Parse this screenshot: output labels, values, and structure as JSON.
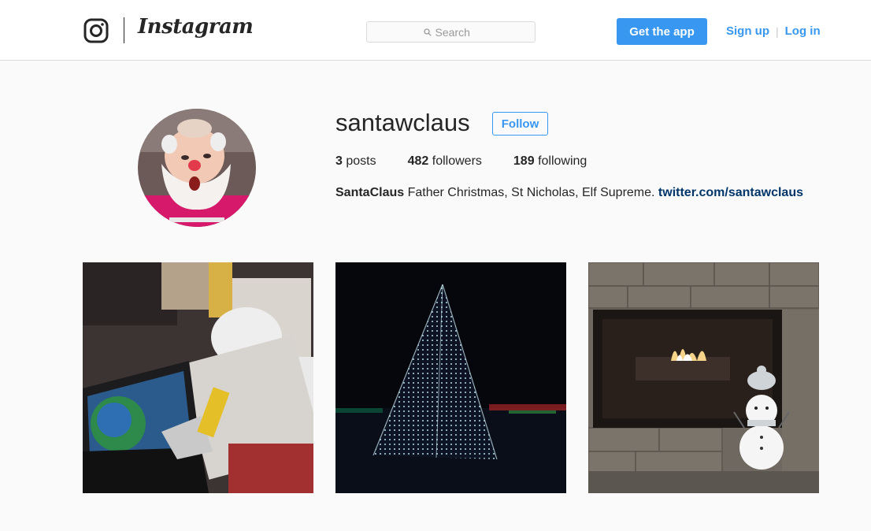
{
  "header": {
    "wordmark": "Instagram",
    "search_placeholder": "Search",
    "get_app_label": "Get the app",
    "signup_label": "Sign up",
    "separator": "|",
    "login_label": "Log in"
  },
  "profile": {
    "username": "santawclaus",
    "follow_label": "Follow",
    "stats": {
      "posts_count": "3",
      "posts_label": "posts",
      "followers_count": "482",
      "followers_label": "followers",
      "following_count": "189",
      "following_label": "following"
    },
    "bio": {
      "full_name": "SantaClaus",
      "text": " Father Christmas, St Nicholas, Elf Supreme. ",
      "link": "twitter.com/santawclaus"
    }
  },
  "posts": [
    {
      "subject": "cluttered desk with laptop"
    },
    {
      "subject": "christmas light tree at night"
    },
    {
      "subject": "fireplace with snowman"
    }
  ],
  "colors": {
    "accent": "#3897f0",
    "link_dark": "#003569",
    "text": "#262626",
    "background": "#fafafa",
    "border": "#dbdbdb"
  }
}
